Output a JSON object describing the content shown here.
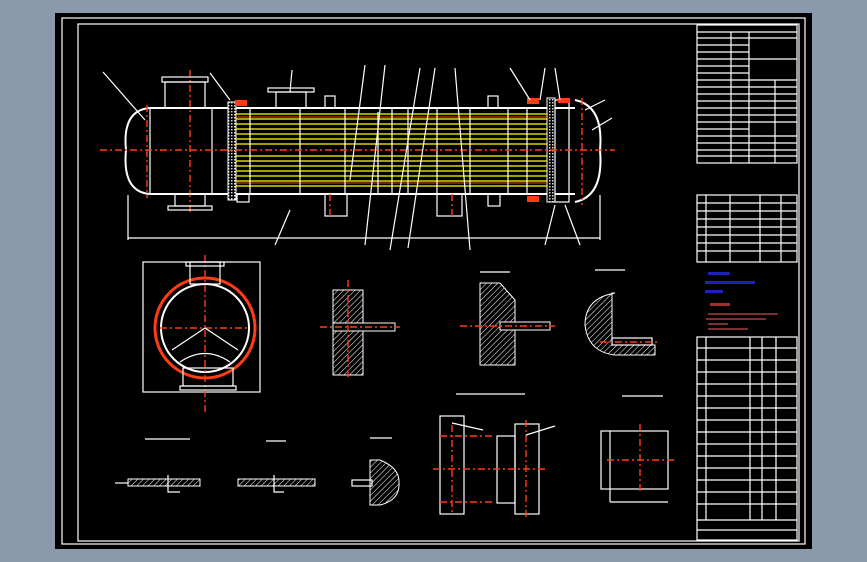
{
  "drawing": {
    "colors": {
      "viewport_background": "#8a9aac",
      "paper": "#000000",
      "outline": "#ffffff",
      "centerline": "#ff3c14",
      "tubes": "#ffff00",
      "annotation_text": "#2020c0"
    },
    "views": [
      "main-elevation",
      "cross-section",
      "detail-1",
      "detail-2",
      "detail-3",
      "weld-detail-1",
      "weld-detail-2",
      "weld-detail-3",
      "baffle-plate-detail",
      "support-detail"
    ],
    "blocks": [
      "title-block",
      "nozzle-table",
      "technical-notes",
      "parts-list"
    ]
  }
}
